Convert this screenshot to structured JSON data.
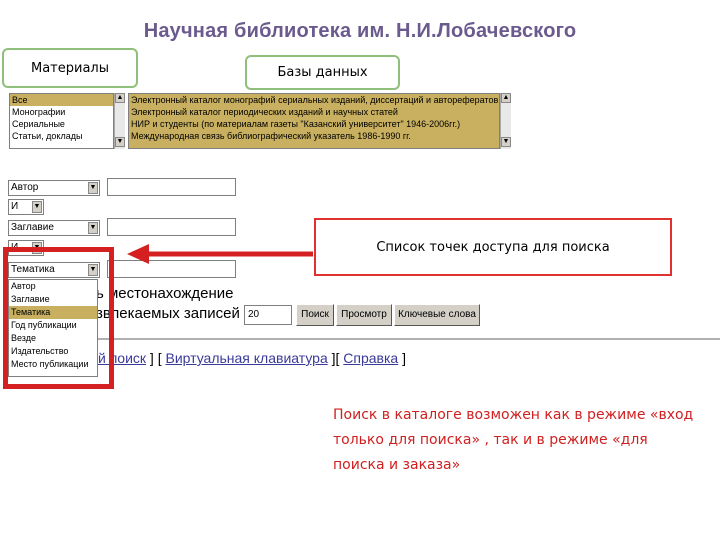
{
  "title": "Научная библиотека им. Н.И.Лобачевского",
  "labels": {
    "materials": "Материалы",
    "databases": "Базы данных"
  },
  "materials_list": [
    "Все",
    "Монографии",
    "Сериальные",
    "Статьи, доклады"
  ],
  "databases_list": [
    "Электронный каталог монографий сериальных изданий, диссертаций и авторефератов",
    "Электронный каталог периодических изданий и научных статей",
    "НИР и студенты (по материалам газеты \"Казанский университет\" 1946-2006гг.)",
    "Международная связь библиографический указатель 1986-1990 гг."
  ],
  "search_form": {
    "field1": "Автор",
    "operator": "И",
    "field2": "Заглавие",
    "operator2": "И",
    "field3": "Тематика"
  },
  "dropdown_options": [
    "Автор",
    "Заглавие",
    "Тематика",
    "Год публикации",
    "Везде",
    "Издательство",
    "Место публикации"
  ],
  "dropdown_selected": "Тематика",
  "partial_texts": {
    "location": "ь местонахождение",
    "records": "звлекаемых записей",
    "records_count": "20"
  },
  "buttons": {
    "search": "Поиск",
    "view": "Просмотр",
    "keywords": "Ключевые слова"
  },
  "links": {
    "prefix": "й поиск",
    "sep1": " ] [ ",
    "virtual_keyboard": "Виртуальная клавиатура",
    "sep2": " ][ ",
    "help": "Справка",
    "end": " ]"
  },
  "callout": "Список точек доступа для поиска",
  "note": "Поиск в каталоге возможен как в режиме «вход только для поиска» , так и в режиме «для поиска и заказа»",
  "colors": {
    "title": "#6b5a8e",
    "highlight": "#d42020",
    "note_text": "#d02020",
    "selection": "#c8b060",
    "label_border": "#8fbf7a"
  }
}
